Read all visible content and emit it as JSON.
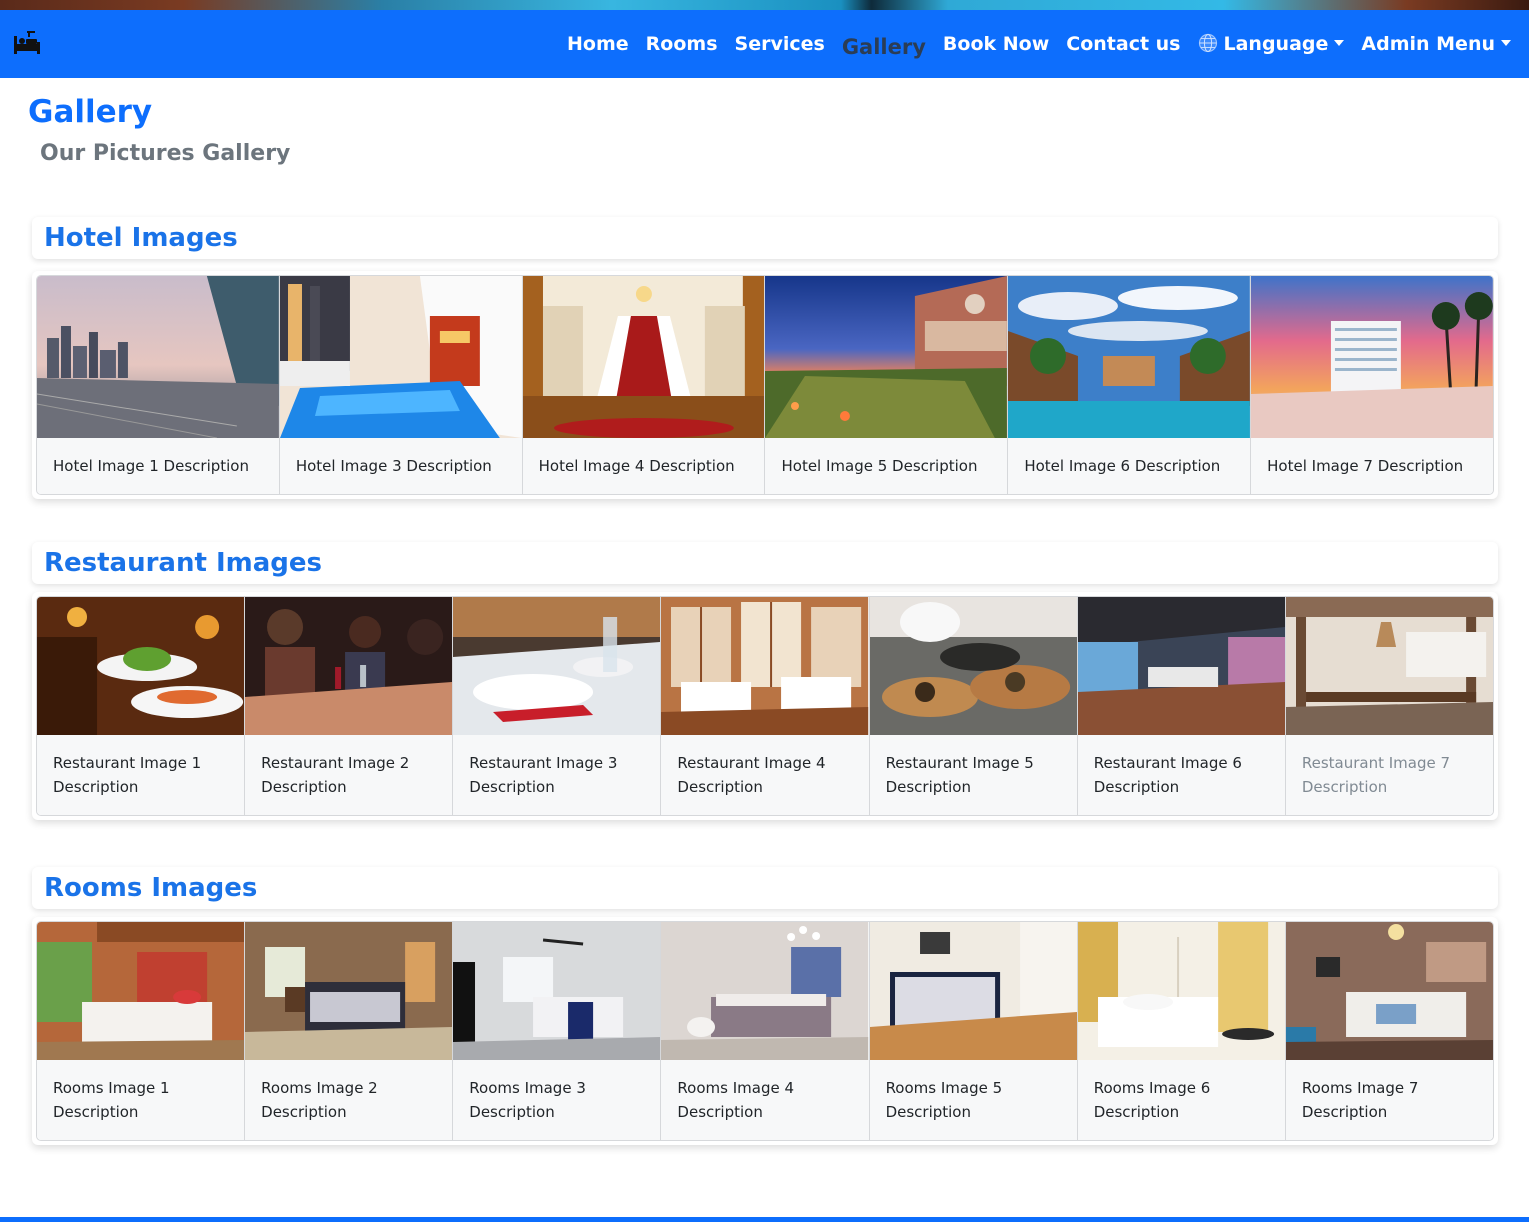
{
  "navbar": {
    "brand_icon": "hotel-bed-icon",
    "items": [
      {
        "label": "Home"
      },
      {
        "label": "Rooms"
      },
      {
        "label": "Services"
      },
      {
        "label": "Gallery",
        "active": true
      },
      {
        "label": "Book Now"
      },
      {
        "label": "Contact us"
      }
    ],
    "language": {
      "label": "Language",
      "icon": "globe-icon"
    },
    "admin": {
      "label": "Admin Menu"
    },
    "background": "#0d6efd"
  },
  "page": {
    "title": "Gallery",
    "subtitle": "Our Pictures Gallery"
  },
  "sections": {
    "hotel": {
      "title": "Hotel Images",
      "cards": [
        {
          "caption": "Hotel Image 1 Description"
        },
        {
          "caption": "Hotel Image 3 Description"
        },
        {
          "caption": "Hotel Image 4 Description"
        },
        {
          "caption": "Hotel Image 5 Description"
        },
        {
          "caption": "Hotel Image 6 Description"
        },
        {
          "caption": "Hotel Image 7 Description"
        }
      ]
    },
    "restaurant": {
      "title": "Restaurant Images",
      "cards": [
        {
          "caption": "Restaurant Image 1 Description"
        },
        {
          "caption": "Restaurant Image 2 Description"
        },
        {
          "caption": "Restaurant Image 3 Description"
        },
        {
          "caption": "Restaurant Image 4 Description"
        },
        {
          "caption": "Restaurant Image 5 Description"
        },
        {
          "caption": "Restaurant Image 6 Description"
        },
        {
          "caption": "Restaurant Image 7 Description"
        }
      ]
    },
    "rooms": {
      "title": "Rooms Images",
      "cards": [
        {
          "caption": "Rooms Image 1 Description"
        },
        {
          "caption": "Rooms Image 2 Description"
        },
        {
          "caption": "Rooms Image 3 Description"
        },
        {
          "caption": "Rooms Image 4 Description"
        },
        {
          "caption": "Rooms Image 5 Description"
        },
        {
          "caption": "Rooms Image 6 Description"
        },
        {
          "caption": "Rooms Image 7 Description"
        }
      ]
    }
  },
  "colors": {
    "primary": "#0d6efd",
    "section_title": "#1a73e8",
    "subtitle": "#6c757d"
  }
}
